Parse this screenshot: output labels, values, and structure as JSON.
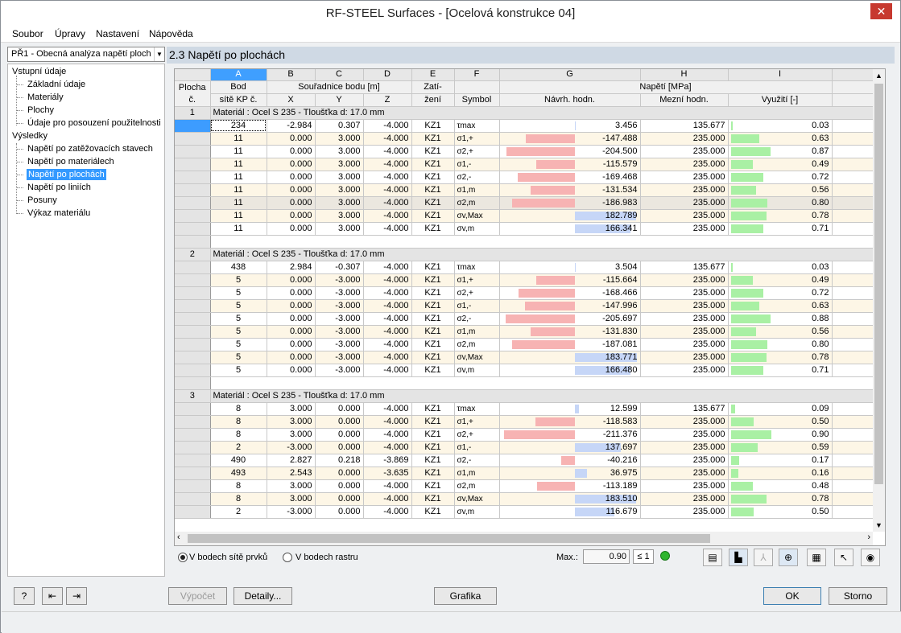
{
  "title": "RF-STEEL Surfaces - [Ocelová konstrukce 04]",
  "menu": [
    "Soubor",
    "Úpravy",
    "Nastavení",
    "Nápověda"
  ],
  "case_select": "PŘ1 - Obecná analýza napětí ploch",
  "tree": {
    "input": "Vstupní údaje",
    "input_items": [
      "Základní údaje",
      "Materiály",
      "Plochy",
      "Údaje pro posouzení použitelnosti"
    ],
    "results": "Výsledky",
    "result_items": [
      "Napětí po zatěžovacích stavech",
      "Napětí po materiálech",
      "Napětí po plochách",
      "Napětí po liniích",
      "Posuny",
      "Výkaz materiálu"
    ],
    "selected": "Napětí po plochách"
  },
  "panel_title": "2.3 Napětí po plochách",
  "columns": {
    "letters": [
      "A",
      "B",
      "C",
      "D",
      "E",
      "F",
      "G",
      "H",
      "I"
    ],
    "h1": [
      "Plocha",
      "Bod",
      "Souřadnice bodu [m]",
      "Zatí-",
      "Napětí [MPa]"
    ],
    "h2": [
      "č.",
      "sítě KP č.",
      "X",
      "Y",
      "Z",
      "žení",
      "Symbol",
      "Návrh. hodn.",
      "Mezní hodn.",
      "Využití [-]"
    ]
  },
  "groups": [
    {
      "no": "1",
      "material": "Materiál : Ocel S 235 - Tloušťka d: 17.0 mm",
      "rows": [
        [
          "234",
          "-2.984",
          "0.307",
          "-4.000",
          "KZ1",
          "τmax",
          "3.456",
          "135.677",
          "0.03"
        ],
        [
          "11",
          "0.000",
          "3.000",
          "-4.000",
          "KZ1",
          "σ1,+",
          "-147.488",
          "235.000",
          "0.63"
        ],
        [
          "11",
          "0.000",
          "3.000",
          "-4.000",
          "KZ1",
          "σ2,+",
          "-204.500",
          "235.000",
          "0.87"
        ],
        [
          "11",
          "0.000",
          "3.000",
          "-4.000",
          "KZ1",
          "σ1,-",
          "-115.579",
          "235.000",
          "0.49"
        ],
        [
          "11",
          "0.000",
          "3.000",
          "-4.000",
          "KZ1",
          "σ2,-",
          "-169.468",
          "235.000",
          "0.72"
        ],
        [
          "11",
          "0.000",
          "3.000",
          "-4.000",
          "KZ1",
          "σ1,m",
          "-131.534",
          "235.000",
          "0.56"
        ],
        [
          "11",
          "0.000",
          "3.000",
          "-4.000",
          "KZ1",
          "σ2,m",
          "-186.983",
          "235.000",
          "0.80"
        ],
        [
          "11",
          "0.000",
          "3.000",
          "-4.000",
          "KZ1",
          "σv,Max",
          "182.789",
          "235.000",
          "0.78"
        ],
        [
          "11",
          "0.000",
          "3.000",
          "-4.000",
          "KZ1",
          "σv,m",
          "166.341",
          "235.000",
          "0.71"
        ]
      ]
    },
    {
      "no": "2",
      "material": "Materiál : Ocel S 235 - Tloušťka d: 17.0 mm",
      "rows": [
        [
          "438",
          "2.984",
          "-0.307",
          "-4.000",
          "KZ1",
          "τmax",
          "3.504",
          "135.677",
          "0.03"
        ],
        [
          "5",
          "0.000",
          "-3.000",
          "-4.000",
          "KZ1",
          "σ1,+",
          "-115.664",
          "235.000",
          "0.49"
        ],
        [
          "5",
          "0.000",
          "-3.000",
          "-4.000",
          "KZ1",
          "σ2,+",
          "-168.466",
          "235.000",
          "0.72"
        ],
        [
          "5",
          "0.000",
          "-3.000",
          "-4.000",
          "KZ1",
          "σ1,-",
          "-147.996",
          "235.000",
          "0.63"
        ],
        [
          "5",
          "0.000",
          "-3.000",
          "-4.000",
          "KZ1",
          "σ2,-",
          "-205.697",
          "235.000",
          "0.88"
        ],
        [
          "5",
          "0.000",
          "-3.000",
          "-4.000",
          "KZ1",
          "σ1,m",
          "-131.830",
          "235.000",
          "0.56"
        ],
        [
          "5",
          "0.000",
          "-3.000",
          "-4.000",
          "KZ1",
          "σ2,m",
          "-187.081",
          "235.000",
          "0.80"
        ],
        [
          "5",
          "0.000",
          "-3.000",
          "-4.000",
          "KZ1",
          "σv,Max",
          "183.771",
          "235.000",
          "0.78"
        ],
        [
          "5",
          "0.000",
          "-3.000",
          "-4.000",
          "KZ1",
          "σv,m",
          "166.480",
          "235.000",
          "0.71"
        ]
      ]
    },
    {
      "no": "3",
      "material": "Materiál : Ocel S 235 - Tloušťka d: 17.0 mm",
      "rows": [
        [
          "8",
          "3.000",
          "0.000",
          "-4.000",
          "KZ1",
          "τmax",
          "12.599",
          "135.677",
          "0.09"
        ],
        [
          "8",
          "3.000",
          "0.000",
          "-4.000",
          "KZ1",
          "σ1,+",
          "-118.583",
          "235.000",
          "0.50"
        ],
        [
          "8",
          "3.000",
          "0.000",
          "-4.000",
          "KZ1",
          "σ2,+",
          "-211.376",
          "235.000",
          "0.90"
        ],
        [
          "2",
          "-3.000",
          "0.000",
          "-4.000",
          "KZ1",
          "σ1,-",
          "137.697",
          "235.000",
          "0.59"
        ],
        [
          "490",
          "2.827",
          "0.218",
          "-3.869",
          "KZ1",
          "σ2,-",
          "-40.216",
          "235.000",
          "0.17"
        ],
        [
          "493",
          "2.543",
          "0.000",
          "-3.635",
          "KZ1",
          "σ1,m",
          "36.975",
          "235.000",
          "0.16"
        ],
        [
          "8",
          "3.000",
          "0.000",
          "-4.000",
          "KZ1",
          "σ2,m",
          "-113.189",
          "235.000",
          "0.48"
        ],
        [
          "8",
          "3.000",
          "0.000",
          "-4.000",
          "KZ1",
          "σv,Max",
          "183.510",
          "235.000",
          "0.78"
        ],
        [
          "2",
          "-3.000",
          "0.000",
          "-4.000",
          "KZ1",
          "σv,m",
          "116.679",
          "235.000",
          "0.50"
        ]
      ]
    }
  ],
  "options": {
    "radio1": "V bodech sítě prvků",
    "radio2": "V bodech rastru",
    "max_label": "Max.:",
    "max_value": "0.90",
    "le1": "≤ 1"
  },
  "buttons": {
    "calc": "Výpočet",
    "details": "Detaily...",
    "graphics": "Grafika",
    "ok": "OK",
    "cancel": "Storno"
  }
}
